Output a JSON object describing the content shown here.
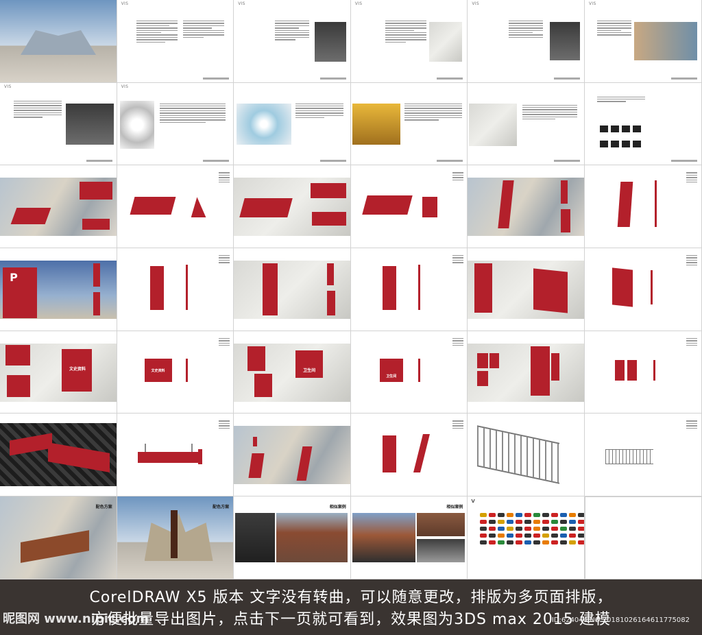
{
  "pages_header": "VIS",
  "banner": {
    "line1": "CorelDRAW X5 版本  文字没有转曲，可以随意更改，排版为多页面排版，",
    "line2": "方便批量导出图片，点击下一页就可看到，效果图为3DS max 2015 建模"
  },
  "watermark": "昵图网 www.nipic.com",
  "id_label": "ID:624044 NO:20181026164611775082",
  "sign_labels": {
    "parking": "P",
    "culture": "文史资料",
    "toilet": "卫生间",
    "scheme1": "配色方案",
    "scheme2": "配色方案",
    "case1": "相似案例",
    "case2": "相似案例"
  },
  "colors": {
    "brand_red": "#b3202b",
    "banner_bg": "#3a3431",
    "accent": "#d68a00"
  }
}
